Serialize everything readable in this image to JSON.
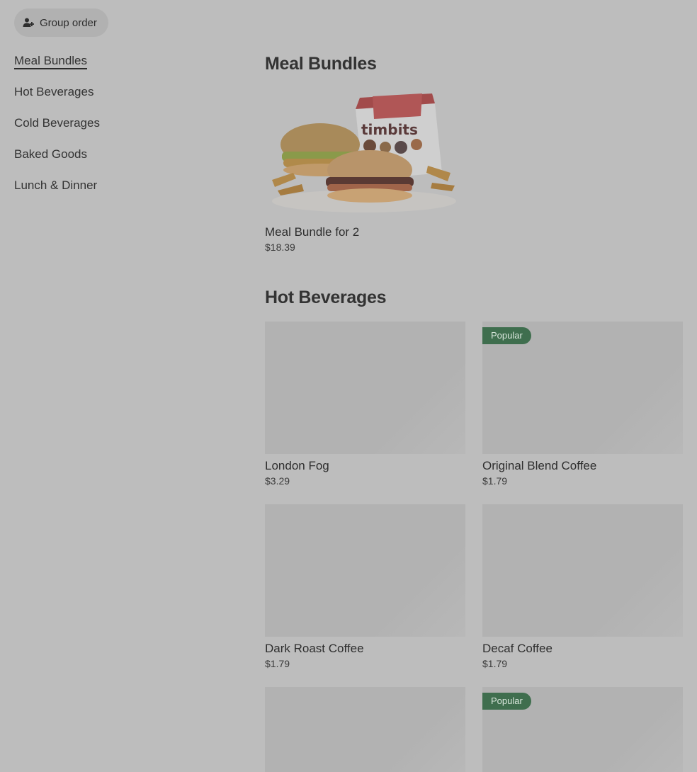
{
  "header": {
    "group_order_label": "Group order"
  },
  "sidebar": {
    "items": [
      {
        "label": "Meal Bundles"
      },
      {
        "label": "Hot Beverages"
      },
      {
        "label": "Cold Beverages"
      },
      {
        "label": "Baked Goods"
      },
      {
        "label": "Lunch & Dinner"
      }
    ]
  },
  "sections": {
    "meal_bundles": {
      "title": "Meal Bundles",
      "items": [
        {
          "name": "Meal Bundle for 2",
          "price": "$18.39",
          "box_text": "timbits"
        }
      ]
    },
    "hot_beverages": {
      "title": "Hot Beverages",
      "popular_label": "Popular",
      "items": [
        {
          "name": "London Fog",
          "price": "$3.29"
        },
        {
          "name": "Original Blend Coffee",
          "price": "$1.79",
          "badge": "Popular"
        },
        {
          "name": "Dark Roast Coffee",
          "price": "$1.79"
        },
        {
          "name": "Decaf Coffee",
          "price": "$1.79"
        },
        {
          "name": "",
          "price": ""
        },
        {
          "name": "",
          "price": "",
          "badge": "Popular"
        }
      ]
    }
  },
  "colors": {
    "badge": "#3f6e4e",
    "overlay": "#bdbdbd"
  }
}
